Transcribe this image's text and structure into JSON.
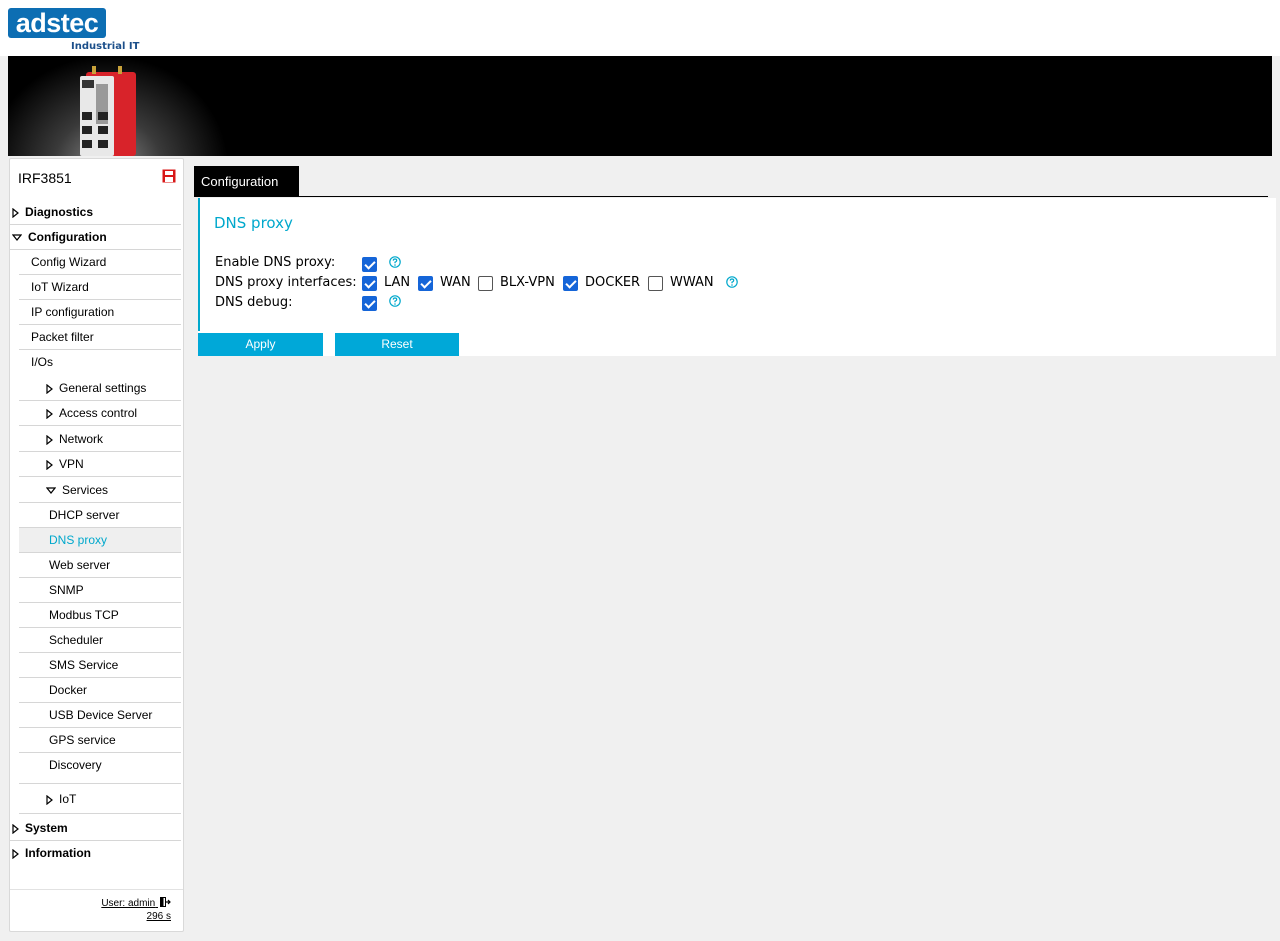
{
  "header": {
    "logo_text": "adstec",
    "logo_subtitle": "Industrial IT"
  },
  "sidebar": {
    "device_name": "IRF3851",
    "items": [
      {
        "label": "Diagnostics"
      },
      {
        "label": "Configuration"
      },
      {
        "label": "Config Wizard"
      },
      {
        "label": "IoT Wizard"
      },
      {
        "label": "IP configuration"
      },
      {
        "label": "Packet filter"
      },
      {
        "label": "I/Os"
      },
      {
        "label": "General settings"
      },
      {
        "label": "Access control"
      },
      {
        "label": "Network"
      },
      {
        "label": "VPN"
      },
      {
        "label": "Services"
      },
      {
        "label": "DHCP server"
      },
      {
        "label": "DNS proxy"
      },
      {
        "label": "Web server"
      },
      {
        "label": "SNMP"
      },
      {
        "label": "Modbus TCP"
      },
      {
        "label": "Scheduler"
      },
      {
        "label": "SMS Service"
      },
      {
        "label": "Docker"
      },
      {
        "label": "USB Device Server"
      },
      {
        "label": "GPS service"
      },
      {
        "label": "Discovery"
      },
      {
        "label": "IoT"
      },
      {
        "label": "System"
      },
      {
        "label": "Information"
      }
    ],
    "user_label": "User: admin",
    "session_timer": "296 s"
  },
  "main": {
    "tab_label": "Configuration",
    "panel_title": "DNS proxy",
    "enable_label": "Enable DNS proxy:",
    "interfaces_label": "DNS proxy interfaces:",
    "debug_label": "DNS debug:",
    "interfaces": [
      {
        "label": "LAN",
        "checked": true
      },
      {
        "label": "WAN",
        "checked": true
      },
      {
        "label": "BLX-VPN",
        "checked": false
      },
      {
        "label": "DOCKER",
        "checked": true
      },
      {
        "label": "WWAN",
        "checked": false
      }
    ],
    "enable_checked": true,
    "debug_checked": true,
    "apply_label": "Apply",
    "reset_label": "Reset"
  },
  "colors": {
    "accent": "#00a8cc",
    "button": "#00a8d8",
    "checkbox": "#1565d8",
    "brand": "#0d6eb3"
  }
}
